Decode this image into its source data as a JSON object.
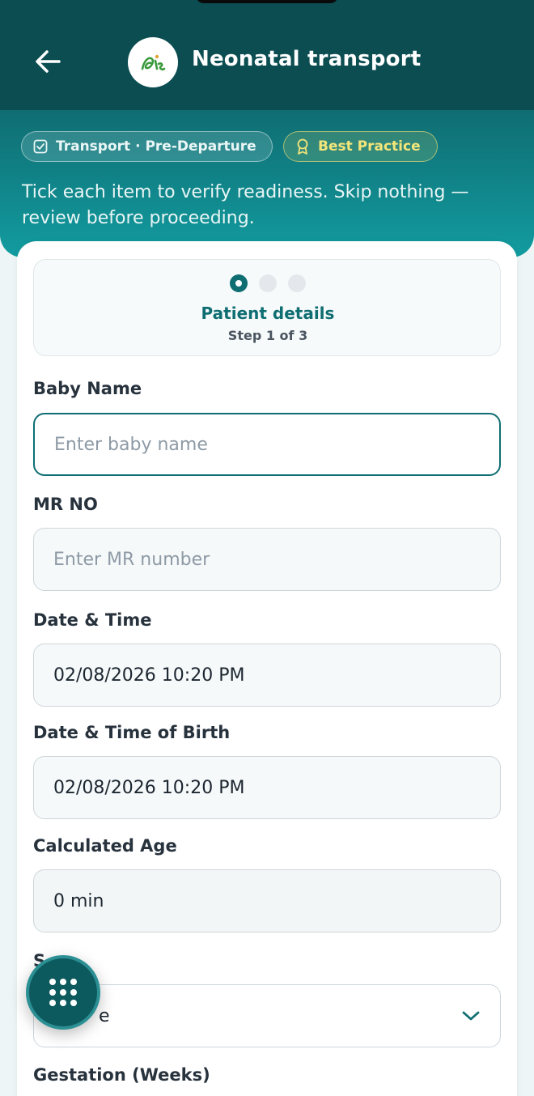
{
  "header": {
    "title": "Neonatal transport",
    "chip_transport": "Transport · Pre-Departure",
    "chip_best": "Best Practice",
    "subtitle": "Tick each item to verify readiness. Skip nothing — review before proceeding."
  },
  "stepper": {
    "title": "Patient details",
    "subtitle": "Step 1 of 3",
    "current_step": 1,
    "total_steps": 3
  },
  "form": {
    "baby_name": {
      "label": "Baby Name",
      "placeholder": "Enter baby name",
      "value": ""
    },
    "mr_no": {
      "label": "MR NO",
      "placeholder": "Enter MR number",
      "value": ""
    },
    "date_time": {
      "label": "Date & Time",
      "value": "02/08/2026 10:20 PM"
    },
    "date_time_birth": {
      "label": "Date & Time of Birth",
      "value": "02/08/2026 10:20 PM"
    },
    "calculated_age": {
      "label": "Calculated Age",
      "value": "0 min"
    },
    "sex": {
      "label": "S",
      "value": "e"
    },
    "gestation": {
      "label": "Gestation (Weeks)"
    }
  },
  "colors": {
    "primary": "#0f6e72",
    "header_dark": "#0b4d51",
    "best_practice": "#f3e57a"
  },
  "icons": {
    "back": "arrow-left-icon",
    "logo": "app-logo-icon",
    "checklist": "checkbox-icon",
    "award": "award-icon",
    "chevron": "chevron-down-icon",
    "fab": "grid-dots-icon"
  }
}
